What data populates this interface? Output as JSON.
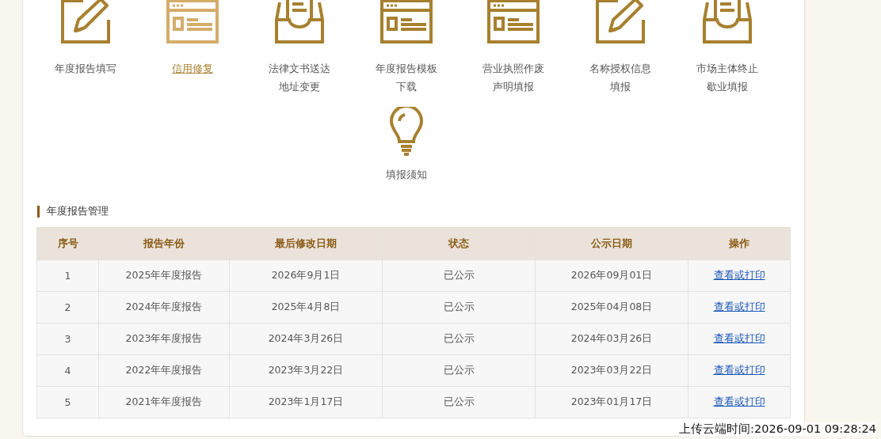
{
  "services": [
    {
      "kind": "pencil",
      "label": "年度报告填写",
      "selected": false
    },
    {
      "kind": "form",
      "label": "信用修复",
      "selected": true
    },
    {
      "kind": "inbox",
      "label": "法律文书送达地址变更",
      "selected": false
    },
    {
      "kind": "form",
      "label": "年度报告模板下载",
      "selected": false
    },
    {
      "kind": "form",
      "label": "营业执照作废声明填报",
      "selected": false
    },
    {
      "kind": "pencil",
      "label": "名称授权信息填报",
      "selected": false
    },
    {
      "kind": "inbox",
      "label": "市场主体终止歇业填报",
      "selected": false
    },
    {
      "kind": "bulb",
      "label": "填报须知",
      "selected": false
    }
  ],
  "section_title": "年度报告管理",
  "table": {
    "columns": [
      "序号",
      "报告年份",
      "最后修改日期",
      "状态",
      "公示日期",
      "操作"
    ],
    "rows": [
      [
        "1",
        "2025年年度报告",
        "2026年9月1日",
        "已公示",
        "2026年09月01日",
        "查看或打印"
      ],
      [
        "2",
        "2024年年度报告",
        "2025年4月8日",
        "已公示",
        "2025年04月08日",
        "查看或打印"
      ],
      [
        "3",
        "2023年年度报告",
        "2024年3月26日",
        "已公示",
        "2024年03月26日",
        "查看或打印"
      ],
      [
        "4",
        "2022年年度报告",
        "2023年3月22日",
        "已公示",
        "2023年03月22日",
        "查看或打印"
      ],
      [
        "5",
        "2021年年度报告",
        "2023年1月17日",
        "已公示",
        "2023年01月17日",
        "查看或打印"
      ]
    ]
  },
  "upload_time": "上传云端时间:2026-09-01 09:28:24"
}
